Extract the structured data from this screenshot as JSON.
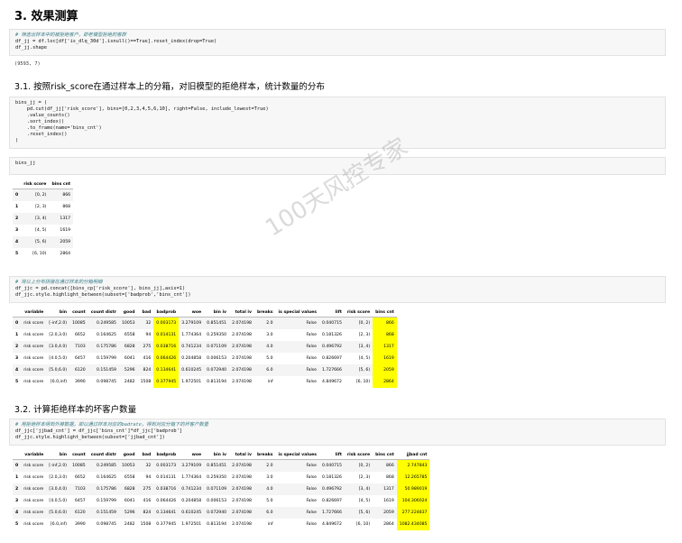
{
  "section_title": "3. 效果测算",
  "cell1": {
    "lines": [
      "# 筛选出样本中的被拒绝客户，即老模型拒绝的客群",
      "df_jj = df.loc[df['is_dlq_30d'].isnull()==True].reset_index(drop=True)",
      "df_jj.shape"
    ],
    "output": "(9593, 7)"
  },
  "subsection1_title": "3.1. 按照risk_score在通过样本上的分箱，对旧模型的拒绝样本，统计数量的分布",
  "cell2": {
    "lines": [
      "bins_jj = (",
      "    pd.cut(df_jj['risk_score'], bins=[0,2,3,4,5,6,10], right=False, include_lowest=True)",
      "    .value_counts()",
      "    .sort_index()",
      "    .to_frame(name='bins_cnt')",
      "    .reset_index()",
      ")"
    ]
  },
  "cell3": {
    "lines": [
      "bins_jj"
    ]
  },
  "bins_table": {
    "headers": [
      "",
      "risk score",
      "bins cnt"
    ],
    "rows": [
      [
        "0",
        "[0, 2)",
        "866"
      ],
      [
        "1",
        "[2, 3)",
        "868"
      ],
      [
        "2",
        "[3, 4)",
        "1317"
      ],
      [
        "3",
        "[4, 5)",
        "1619"
      ],
      [
        "4",
        "[5, 6)",
        "2059"
      ],
      [
        "5",
        "[6, 10)",
        "2864"
      ]
    ]
  },
  "cell4": {
    "lines": [
      "# 将以上分布拼接在通过样本的分箱明细",
      "df_jjc = pd.concat([bins_cp['risk_score'], bins_jj],axis=1)",
      "df_jjc.style.highlight_between(subset=['badprob','bins_cnt'])"
    ]
  },
  "table1": {
    "headers": [
      "",
      "variable",
      "bin",
      "count",
      "count distr",
      "good",
      "bad",
      "badprob",
      "woe",
      "bin iv",
      "total iv",
      "breaks",
      "is special values",
      "lift",
      "risk score",
      "bins cnt"
    ],
    "rows": [
      [
        "0",
        "risk score",
        "[-inf,2.0)",
        "10085",
        "0.249585",
        "10053",
        "32",
        "0.003173",
        "3.279109",
        "0.851451",
        "2.074198",
        "2.0",
        "False",
        "0.040715",
        "[0, 2)",
        "866"
      ],
      [
        "1",
        "risk score",
        "[2.0,3.0)",
        "6652",
        "0.164625",
        "6558",
        "94",
        "0.014131",
        "1.774364",
        "0.259350",
        "2.074198",
        "3.0",
        "False",
        "0.181326",
        "[2, 3)",
        "868"
      ],
      [
        "2",
        "risk score",
        "[3.0,4.0)",
        "7103",
        "0.175786",
        "6828",
        "275",
        "0.038716",
        "0.741234",
        "0.071109",
        "2.074198",
        "4.0",
        "False",
        "0.496792",
        "[3, 4)",
        "1317"
      ],
      [
        "3",
        "risk score",
        "[4.0,5.0)",
        "6457",
        "0.159799",
        "6041",
        "416",
        "0.064426",
        "0.204858",
        "0.006153",
        "2.074198",
        "5.0",
        "False",
        "0.826697",
        "[4, 5)",
        "1619"
      ],
      [
        "4",
        "risk score",
        "[5.0,6.0)",
        "6120",
        "0.151459",
        "5296",
        "824",
        "0.134641",
        "0.610245",
        "0.072940",
        "2.074198",
        "6.0",
        "False",
        "1.727666",
        "[5, 6)",
        "2059"
      ],
      [
        "5",
        "risk score",
        "[6.0,inf)",
        "3990",
        "0.098745",
        "2482",
        "1508",
        "0.377945",
        "1.972501",
        "0.813194",
        "2.074198",
        "inf",
        "False",
        "4.849672",
        "[6, 10)",
        "2864"
      ]
    ]
  },
  "subsection2_title": "3.2. 计算拒绝样本的坏客户数量",
  "cell5": {
    "lines": [
      "# 用拒绝样本得到外推数据，即以通过样本对应的badrate，得到对应分箱下的坏客户数量",
      "df_jjc['jjbad_cnt'] = df_jjc['bins_cnt']*df_jjc['badprob']",
      "df_jjc.style.highlight_between(subset=['jjbad_cnt'])"
    ]
  },
  "table2": {
    "headers": [
      "",
      "variable",
      "bin",
      "count",
      "count distr",
      "good",
      "bad",
      "badprob",
      "woe",
      "bin iv",
      "total iv",
      "breaks",
      "is special values",
      "lift",
      "risk score",
      "bins cnt",
      "jjbad cnt"
    ],
    "rows": [
      [
        "0",
        "risk score",
        "[-inf,2.0)",
        "10085",
        "0.249585",
        "10053",
        "32",
        "0.003173",
        "3.279109",
        "0.851451",
        "2.074198",
        "2.0",
        "False",
        "0.040715",
        "[0, 2)",
        "866",
        "2.747843"
      ],
      [
        "1",
        "risk score",
        "[2.0,3.0)",
        "6652",
        "0.164625",
        "6558",
        "94",
        "0.014131",
        "1.774364",
        "0.259350",
        "2.074198",
        "3.0",
        "False",
        "0.181326",
        "[2, 3)",
        "868",
        "12.265785"
      ],
      [
        "2",
        "risk score",
        "[3.0,4.0)",
        "7103",
        "0.175786",
        "6828",
        "275",
        "0.038716",
        "0.741234",
        "0.071109",
        "2.074198",
        "4.0",
        "False",
        "0.496792",
        "[3, 4)",
        "1317",
        "50.989019"
      ],
      [
        "3",
        "risk score",
        "[4.0,5.0)",
        "6457",
        "0.159799",
        "6041",
        "416",
        "0.064426",
        "0.204858",
        "0.006153",
        "2.074198",
        "5.0",
        "False",
        "0.826697",
        "[4, 5)",
        "1619",
        "104.306024"
      ],
      [
        "4",
        "risk score",
        "[5.0,6.0)",
        "6120",
        "0.151459",
        "5296",
        "824",
        "0.134641",
        "0.610245",
        "0.072940",
        "2.074198",
        "6.0",
        "False",
        "1.727666",
        "[5, 6)",
        "2059",
        "277.224837"
      ],
      [
        "5",
        "risk score",
        "[6.0,inf)",
        "3990",
        "0.098745",
        "2482",
        "1508",
        "0.377945",
        "1.972501",
        "0.813194",
        "2.074198",
        "inf",
        "False",
        "4.849672",
        "[6, 10)",
        "2864",
        "1082.434085"
      ]
    ]
  },
  "watermark": "100天风控专家",
  "colors": {
    "highlight": "#ffff00",
    "comment": "#3b7e88",
    "code_bg": "#f7f7f7"
  }
}
